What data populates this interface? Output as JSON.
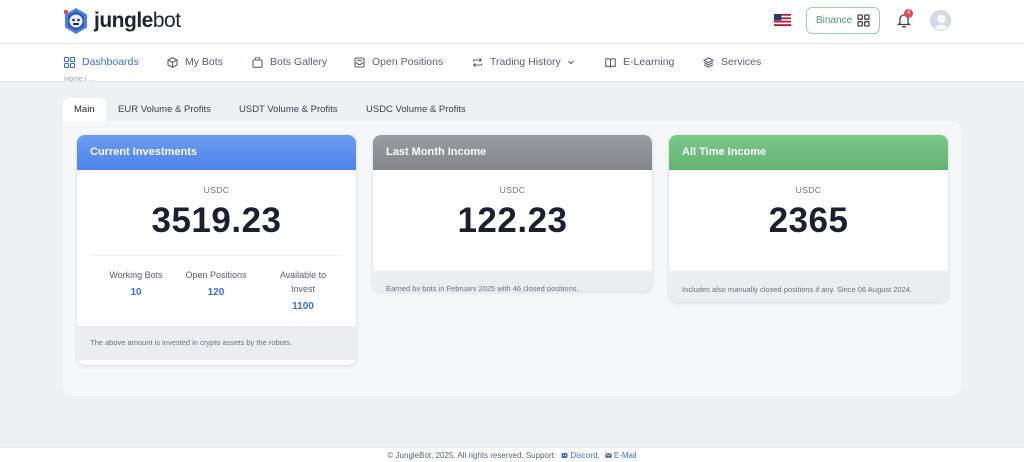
{
  "header": {
    "brand": {
      "name_bold": "jungle",
      "name_light": "bot"
    },
    "language_flag": "us-flag-icon",
    "exchange_button": {
      "label": "Binance",
      "icon": "grid-icon"
    },
    "notifications": {
      "count": "4",
      "icon": "bell-icon"
    },
    "avatar_icon": "user-avatar-icon"
  },
  "nav": {
    "items": [
      {
        "label": "Dashboards",
        "icon": "dashboard-grid-icon",
        "active": true
      },
      {
        "label": "My Bots",
        "icon": "cube-icon"
      },
      {
        "label": "Bots Gallery",
        "icon": "bag-icon"
      },
      {
        "label": "Open Positions",
        "icon": "inbox-icon"
      },
      {
        "label": "Trading History",
        "icon": "repeat-icon",
        "has_dropdown": true
      },
      {
        "label": "E-Learning",
        "icon": "book-icon"
      },
      {
        "label": "Services",
        "icon": "layers-icon"
      }
    ]
  },
  "tabs": [
    {
      "label": "Main",
      "active": true
    },
    {
      "label": "EUR Volume & Profits"
    },
    {
      "label": "USDT Volume & Profits"
    },
    {
      "label": "USDC Volume & Profits"
    }
  ],
  "cards": {
    "current_investments": {
      "title": "Current Investments",
      "color": "#5b8def",
      "unit": "USDC",
      "value": "3519.23",
      "stats": [
        {
          "label": "Working Bots",
          "value": "10"
        },
        {
          "label": "Open Positions",
          "value": "120"
        },
        {
          "label": "Available to Invest",
          "value": "1100"
        }
      ],
      "footnote": "The above amount is invested in crypto assets by the robots."
    },
    "last_month_income": {
      "title": "Last Month Income",
      "color": "#8d8f94",
      "unit": "USDC",
      "value": "122.23",
      "footnote": "Earned by bots in February 2025 with 46 closed positions."
    },
    "all_time_income": {
      "title": "All Time Income",
      "color": "#6fbf7e",
      "unit": "USDC",
      "value": "2365",
      "footnote": "Includes also manually closed positions if any. Since 06 August 2024."
    }
  },
  "footer": {
    "text": "© JungleBot, 2025. All rights reserved. Support:",
    "discord_label": "Discord,",
    "email_label": "E-Mail"
  }
}
